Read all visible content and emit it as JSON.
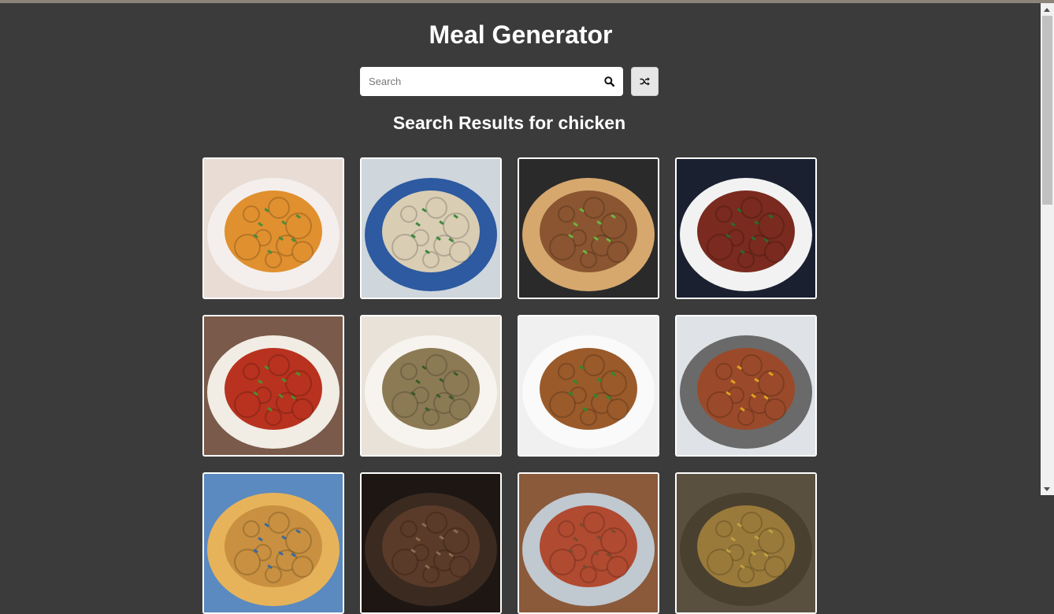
{
  "app": {
    "title": "Meal Generator"
  },
  "search": {
    "placeholder": "Search",
    "value": ""
  },
  "results": {
    "heading": "Search Results for chicken"
  },
  "icons": {
    "search": "search-icon",
    "random": "shuffle-icon"
  },
  "colors": {
    "background": "#3b3b3b",
    "text": "#ffffff",
    "card_border": "#ffffff"
  },
  "meals": [
    {
      "icon": "chicken-curry-image",
      "plate": "#f4efec",
      "food": "#e0902f",
      "accent": "#4a8c3a",
      "bg": "#e8dcd4"
    },
    {
      "icon": "congee-bowl-image",
      "plate": "#2d5aa0",
      "food": "#d9cdb4",
      "accent": "#3d8a3d",
      "bg": "#cfd6dc"
    },
    {
      "icon": "grilled-chicken-image",
      "plate": "#d6a86e",
      "food": "#8a5530",
      "accent": "#6db33f",
      "bg": "#2a2a2a"
    },
    {
      "icon": "chicken-stew-pot-image",
      "plate": "#f2f2f2",
      "food": "#7a2a1e",
      "accent": "#2b6a2b",
      "bg": "#1a2030"
    },
    {
      "icon": "tandoori-chicken-image",
      "plate": "#f1ece4",
      "food": "#b8321f",
      "accent": "#4c8f2f",
      "bg": "#7a5a4a"
    },
    {
      "icon": "chicken-rice-bowl-image",
      "plate": "#f7f4ef",
      "food": "#8c7a55",
      "accent": "#3a5a2a",
      "bg": "#e9e2d8"
    },
    {
      "icon": "chicken-stir-fry-image",
      "plate": "#fafafa",
      "food": "#9a5a2a",
      "accent": "#2e8a2e",
      "bg": "#f0f0f0"
    },
    {
      "icon": "chicken-casserole-image",
      "plate": "#6a6a6a",
      "food": "#9a4a2a",
      "accent": "#e0a020",
      "bg": "#dfe2e6"
    },
    {
      "icon": "meal-image-9",
      "plate": "#e7b35a",
      "food": "#c89040",
      "accent": "#3a6aa0",
      "bg": "#5a8ac0"
    },
    {
      "icon": "meal-image-10",
      "plate": "#3a2a20",
      "food": "#5a3a28",
      "accent": "#8a6a50",
      "bg": "#1e1612"
    },
    {
      "icon": "meal-image-11",
      "plate": "#c0c8d0",
      "food": "#b04a30",
      "accent": "#7a4a30",
      "bg": "#8a5a3a"
    },
    {
      "icon": "meal-image-12",
      "plate": "#4a4030",
      "food": "#9a7a3a",
      "accent": "#c0a040",
      "bg": "#5a5040"
    }
  ]
}
